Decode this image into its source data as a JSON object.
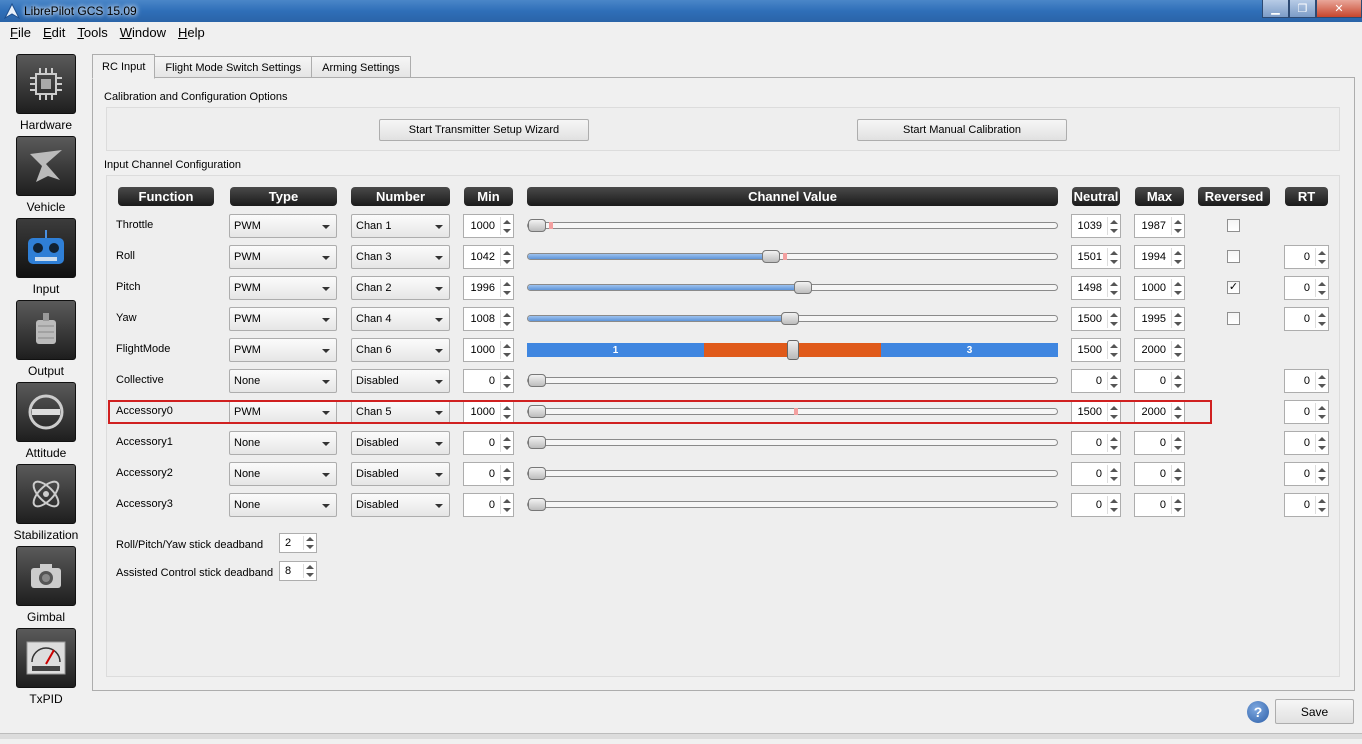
{
  "window": {
    "title": "LibrePilot GCS 15.09"
  },
  "menu": [
    {
      "label": "File",
      "u": "F",
      "rest": "ile"
    },
    {
      "label": "Edit",
      "u": "E",
      "rest": "dit"
    },
    {
      "label": "Tools",
      "u": "T",
      "rest": "ools"
    },
    {
      "label": "Window",
      "u": "W",
      "rest": "indow"
    },
    {
      "label": "Help",
      "u": "H",
      "rest": "elp"
    }
  ],
  "sidebar": [
    {
      "label": "Hardware",
      "icon": "chip-icon"
    },
    {
      "label": "Vehicle",
      "icon": "airplane-icon"
    },
    {
      "label": "Input",
      "icon": "gamepad-icon",
      "active": true
    },
    {
      "label": "Output",
      "icon": "motor-icon"
    },
    {
      "label": "Attitude",
      "icon": "level-icon"
    },
    {
      "label": "Stabilization",
      "icon": "gyro-icon"
    },
    {
      "label": "Gimbal",
      "icon": "camera-icon"
    },
    {
      "label": "TxPID",
      "icon": "meter-icon"
    }
  ],
  "tabs": [
    "RC Input",
    "Flight Mode Switch Settings",
    "Arming Settings"
  ],
  "calibration": {
    "title": "Calibration and Configuration Options",
    "wizard_button": "Start Transmitter Setup Wizard",
    "manual_button": "Start Manual Calibration"
  },
  "config_title": "Input Channel Configuration",
  "columns": [
    "Function",
    "Type",
    "Number",
    "Min",
    "Channel Value",
    "Neutral",
    "Max",
    "Reversed",
    "RT"
  ],
  "rows": [
    {
      "function": "Throttle",
      "type": "PWM",
      "number": "Chan 1",
      "min": "1000",
      "value": 0.0,
      "neutral_mark": 0.04,
      "neutral": "1039",
      "max": "1987",
      "reversed": false,
      "rt": null
    },
    {
      "function": "Roll",
      "type": "PWM",
      "number": "Chan 3",
      "min": "1042",
      "value": 0.458,
      "neutral_mark": 0.48,
      "neutral": "1501",
      "max": "1994",
      "reversed": false,
      "rt": "0"
    },
    {
      "function": "Pitch",
      "type": "PWM",
      "number": "Chan 2",
      "min": "1996",
      "value": 0.518,
      "neutral_mark": 0.51,
      "neutral": "1498",
      "max": "1000",
      "reversed": true,
      "rt": "0"
    },
    {
      "function": "Yaw",
      "type": "PWM",
      "number": "Chan 4",
      "min": "1008",
      "value": 0.494,
      "neutral_mark": 0.5,
      "neutral": "1500",
      "max": "1995",
      "reversed": false,
      "rt": "0"
    },
    {
      "function": "FlightMode",
      "type": "PWM",
      "number": "Chan 6",
      "min": "1000",
      "flightmode": true,
      "modes": [
        "1",
        "",
        "3"
      ],
      "value": 0.5,
      "neutral": "1500",
      "max": "2000",
      "reversed": null,
      "rt": null
    },
    {
      "function": "Collective",
      "type": "None",
      "number": "Disabled",
      "min": "0",
      "value": 0.0,
      "neutral": "0",
      "max": "0",
      "reversed": null,
      "rt": "0"
    },
    {
      "function": "Accessory0",
      "type": "PWM",
      "number": "Chan 5",
      "min": "1000",
      "value": 0.0,
      "neutral_mark": 0.5,
      "neutral": "1500",
      "max": "2000",
      "reversed": null,
      "rt": "0",
      "highlighted": true
    },
    {
      "function": "Accessory1",
      "type": "None",
      "number": "Disabled",
      "min": "0",
      "value": 0.0,
      "neutral": "0",
      "max": "0",
      "reversed": null,
      "rt": "0"
    },
    {
      "function": "Accessory2",
      "type": "None",
      "number": "Disabled",
      "min": "0",
      "value": 0.0,
      "neutral": "0",
      "max": "0",
      "reversed": null,
      "rt": "0"
    },
    {
      "function": "Accessory3",
      "type": "None",
      "number": "Disabled",
      "min": "0",
      "value": 0.0,
      "neutral": "0",
      "max": "0",
      "reversed": null,
      "rt": "0"
    }
  ],
  "deadband": {
    "rpy_label": "Roll/Pitch/Yaw stick deadband",
    "rpy_value": "2",
    "assisted_label": "Assisted Control stick deadband",
    "assisted_value": "8"
  },
  "help_icon": "?",
  "save_label": "Save",
  "colors": {
    "fm_blue": "#3f86e0",
    "fm_orange": "#e05a1a",
    "highlight": "#d02020"
  }
}
